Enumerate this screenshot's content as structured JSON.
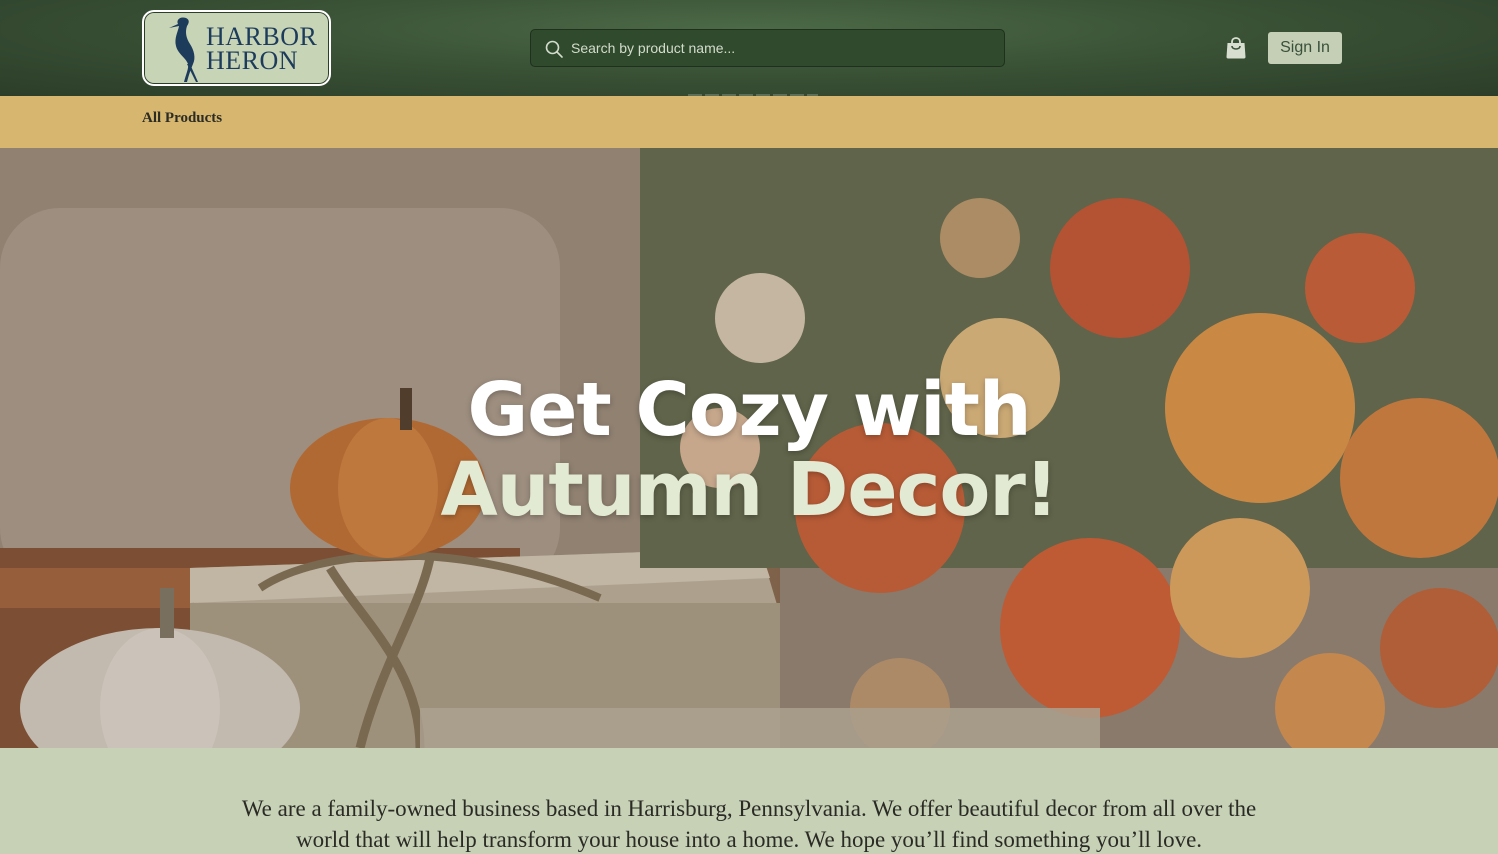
{
  "brand": {
    "name_line1": "HARBOR",
    "name_line2": "HERON",
    "logo_icon": "heron-icon",
    "colors": {
      "header": "#3a5236",
      "nav": "#d7b76f",
      "logo_bg": "#c8d4b6",
      "logo_text": "#1d3c5c",
      "intro_bg": "#c6d1b6"
    }
  },
  "header": {
    "search": {
      "placeholder": "Search by product name...",
      "value": "",
      "icon": "search-icon"
    },
    "cart_icon": "shopping-bag-icon",
    "signin_label": "Sign In"
  },
  "nav": {
    "items": [
      {
        "label": "All Products"
      }
    ]
  },
  "hero": {
    "title_line1": "Get Cozy with",
    "title_line2": "Autumn Decor!"
  },
  "intro": {
    "text": "We are a family-owned business based in Harrisburg, Pennsylvania. We offer beautiful decor from all over the world that will help transform your house into a home. We hope you’ll find something you’ll love."
  }
}
